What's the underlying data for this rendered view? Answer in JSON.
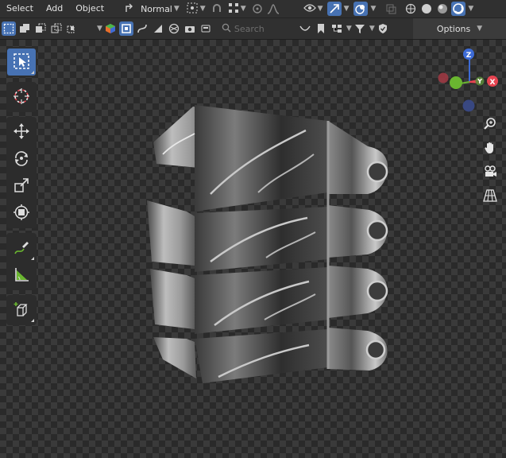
{
  "menu": {
    "select": "Select",
    "add": "Add",
    "object": "Object"
  },
  "transform_orientation": "Normal",
  "search": {
    "placeholder": "Search"
  },
  "options": {
    "label": "Options"
  },
  "gizmo": {
    "z_label": "Z",
    "y_label": "Y",
    "x_label": "X"
  },
  "colors": {
    "accent": "#4772b3",
    "axis_x": "#e64451",
    "axis_y": "#6ab630",
    "axis_z": "#3d6bd6",
    "background": "#303030"
  },
  "icons": {
    "toolshelf": [
      "select-box-icon",
      "cursor-icon",
      "move-icon",
      "rotate-icon",
      "scale-icon",
      "transform-icon",
      "annotate-icon",
      "measure-icon",
      "add-cube-icon"
    ],
    "nav": [
      "zoom-icon",
      "hand-pan-icon",
      "camera-icon",
      "grid-icon"
    ]
  }
}
